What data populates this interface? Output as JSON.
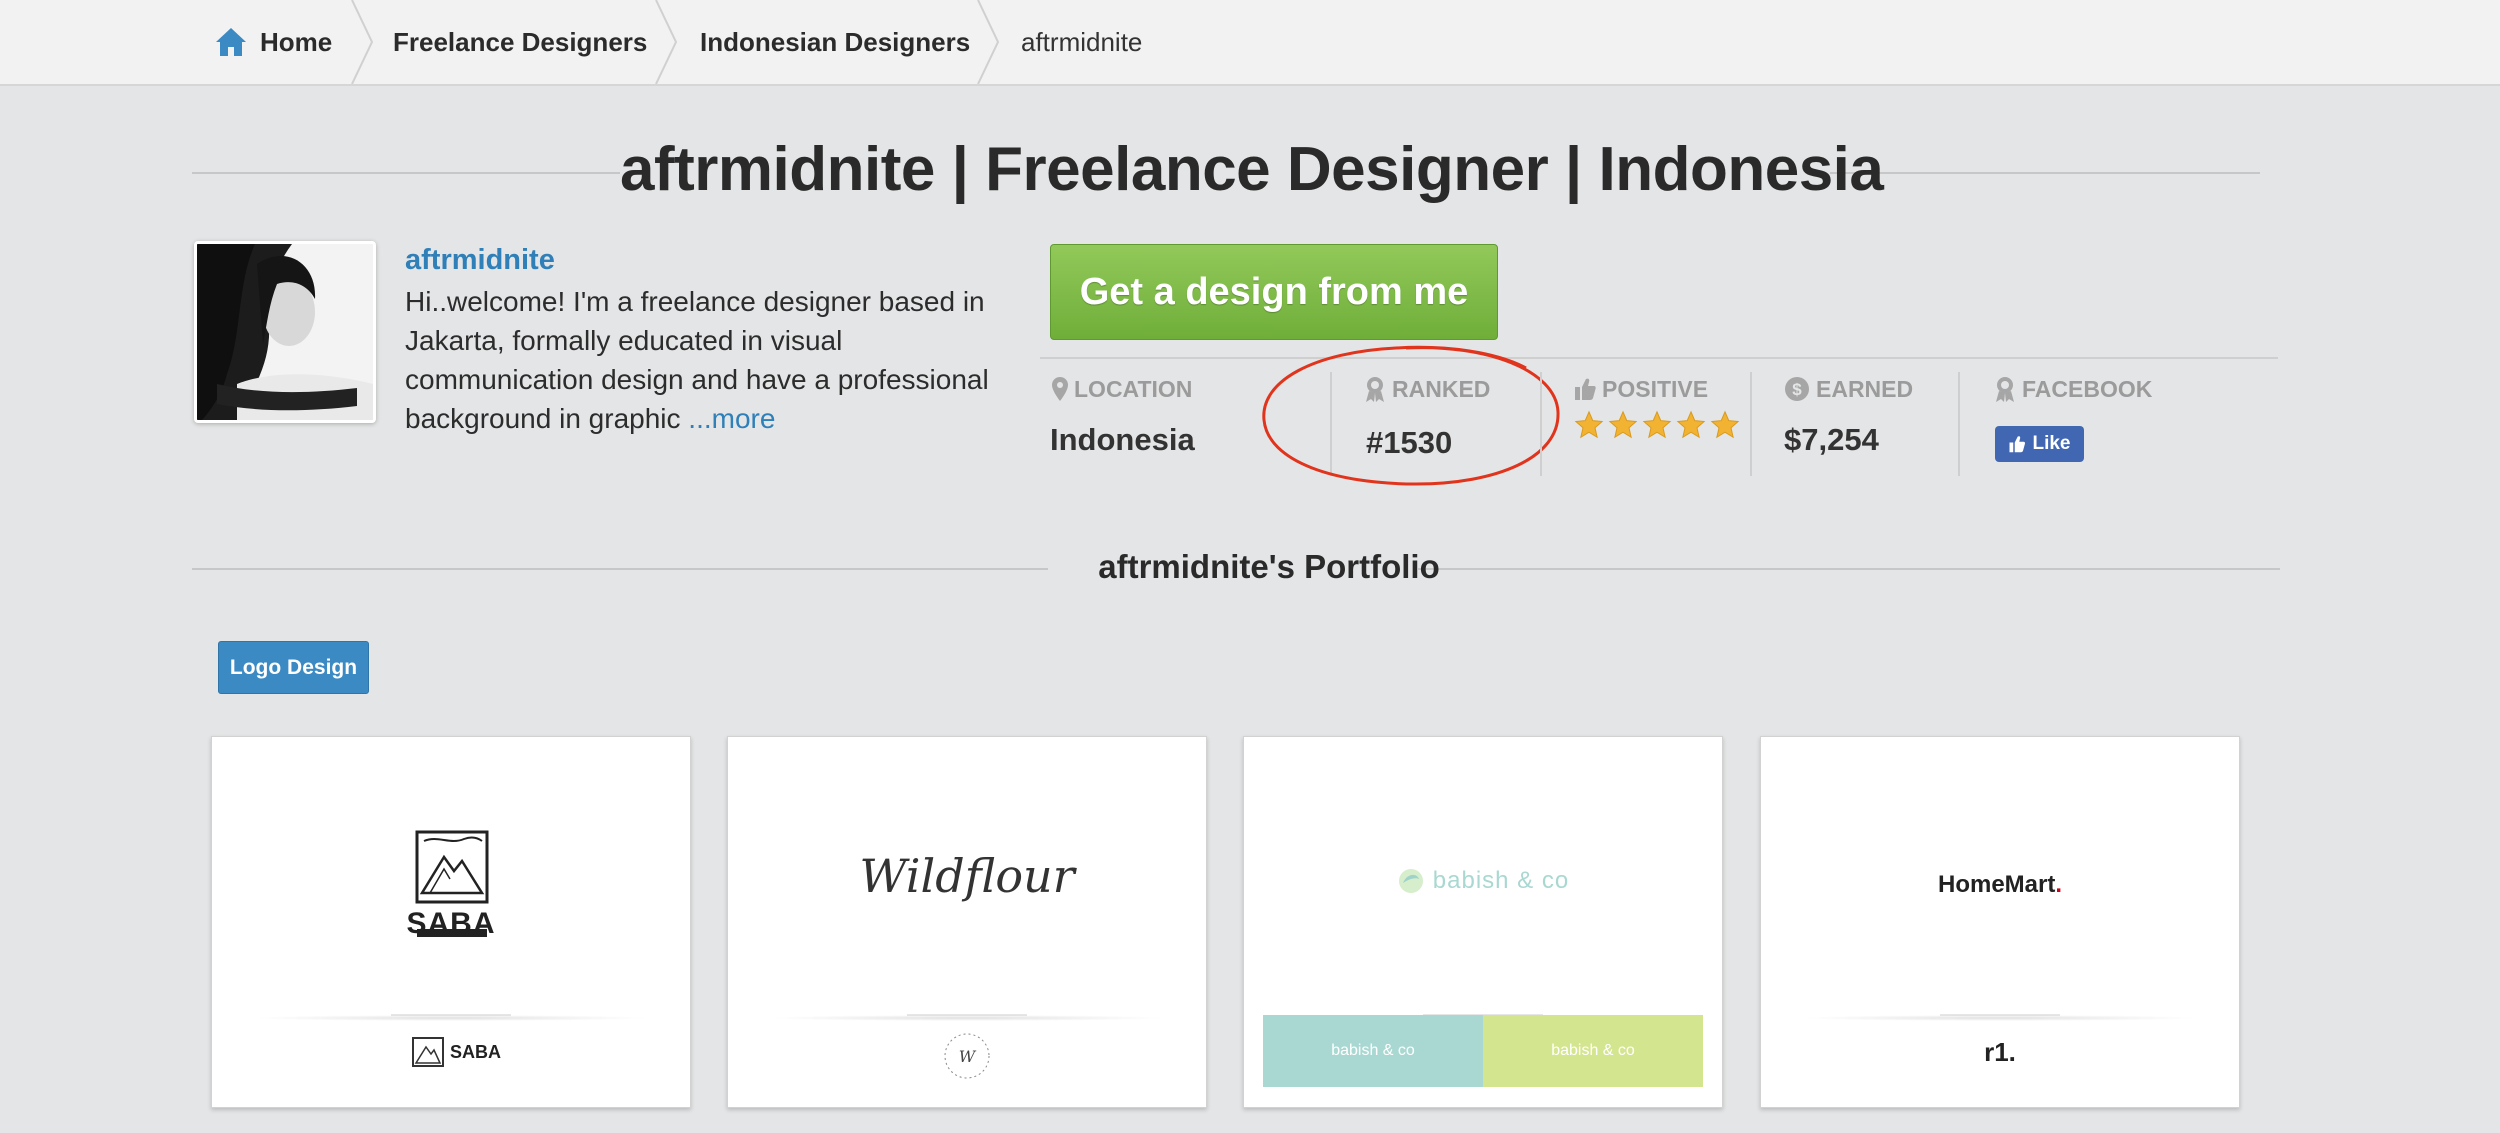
{
  "breadcrumb": {
    "items": [
      {
        "label": "Home"
      },
      {
        "label": "Freelance Designers"
      },
      {
        "label": "Indonesian Designers"
      },
      {
        "label": "aftrmidnite"
      }
    ]
  },
  "page": {
    "title": "aftrmidnite | Freelance Designer | Indonesia"
  },
  "profile": {
    "username": "aftrmidnite",
    "bio": "Hi..welcome! I'm a freelance designer based in Jakarta, formally educated in visual communication design and have a professional background in graphic ",
    "more_label": "...more",
    "cta_label": "Get a design from me"
  },
  "stats": {
    "location_label": "LOCATION",
    "location_value": "Indonesia",
    "ranked_label": "RANKED",
    "ranked_value": "#1530",
    "positive_label": "POSITIVE",
    "positive_rating": 5,
    "positive_rating_max": 5,
    "earned_label": "EARNED",
    "earned_value": "$7,254",
    "facebook_label": "FACEBOOK",
    "like_label": "Like"
  },
  "portfolio": {
    "title": "aftrmidnite's Portfolio",
    "filter_label": "Logo Design",
    "items": [
      {
        "logo_text": "SABA",
        "icon": "mountain-emblem-icon"
      },
      {
        "logo_text": "Wildflour",
        "icon": "wildflour-script-logo"
      },
      {
        "logo_text": "babish & co",
        "icon": "babish-leaf-icon"
      },
      {
        "logo_text": "HomeMart",
        "secondary_text": "r1."
      }
    ]
  },
  "colors": {
    "accent_blue": "#2f7fb8",
    "cta_green": "#7cb844",
    "star_gold": "#f3b332",
    "highlight_red": "#e0341d",
    "facebook_blue": "#4267b2"
  }
}
